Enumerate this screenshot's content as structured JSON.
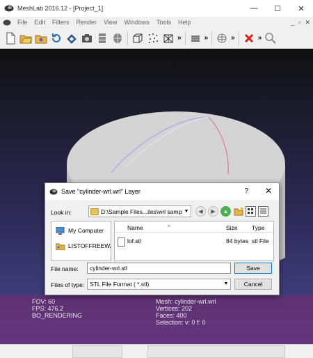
{
  "window": {
    "title": "MeshLab 2016.12 - [Project_1]",
    "controls": [
      "—",
      "☐",
      "✕"
    ]
  },
  "menubar": {
    "items": [
      "File",
      "Edit",
      "Filters",
      "Render",
      "View",
      "Windows",
      "Tools",
      "Help"
    ],
    "mdi_controls": [
      "_",
      "▫",
      "✕"
    ]
  },
  "toolbar": {
    "chevron": "»",
    "icons": [
      "new-document-icon",
      "open-project-icon",
      "open-folder-icon",
      "reload-icon",
      "reload-all-icon",
      "snapshot-icon",
      "layers-icon",
      "save-layer-icon",
      "bounding-box-icon",
      "points-render-icon",
      "wireframe-render-icon",
      "light-icon",
      "trackball-icon",
      "delete-vertices-icon",
      "search-icon"
    ]
  },
  "viewport": {
    "info_left": [
      "FOV: 60",
      "FPS:   476.2",
      "BO_RENDERING"
    ],
    "info_right": [
      "Mesh: cylinder-wrl.wrl",
      "Vertices: 202",
      "Faces: 400",
      "Selection: v: 0 f: 0"
    ]
  },
  "dialog": {
    "title": "Save \"cylinder-wrl.wrl\" Layer",
    "help": "?",
    "close": "✕",
    "look_in_label": "Look in:",
    "look_in_value": "D:\\Sample Files...iles\\wrl sample",
    "sidebar": [
      "My Computer",
      "LISTOFFREEWA"
    ],
    "columns": {
      "name": "Name",
      "size": "Size",
      "type": "Type"
    },
    "files": [
      {
        "name": "lof.stl",
        "size": "84 bytes",
        "type": "stl File"
      }
    ],
    "file_name_label": "File name:",
    "file_name_value": "cylinder-wrl.stl",
    "file_type_label": "Files of type:",
    "file_type_value": "STL File Format ( *.stl)",
    "save_label": "Save",
    "cancel_label": "Cancel"
  }
}
